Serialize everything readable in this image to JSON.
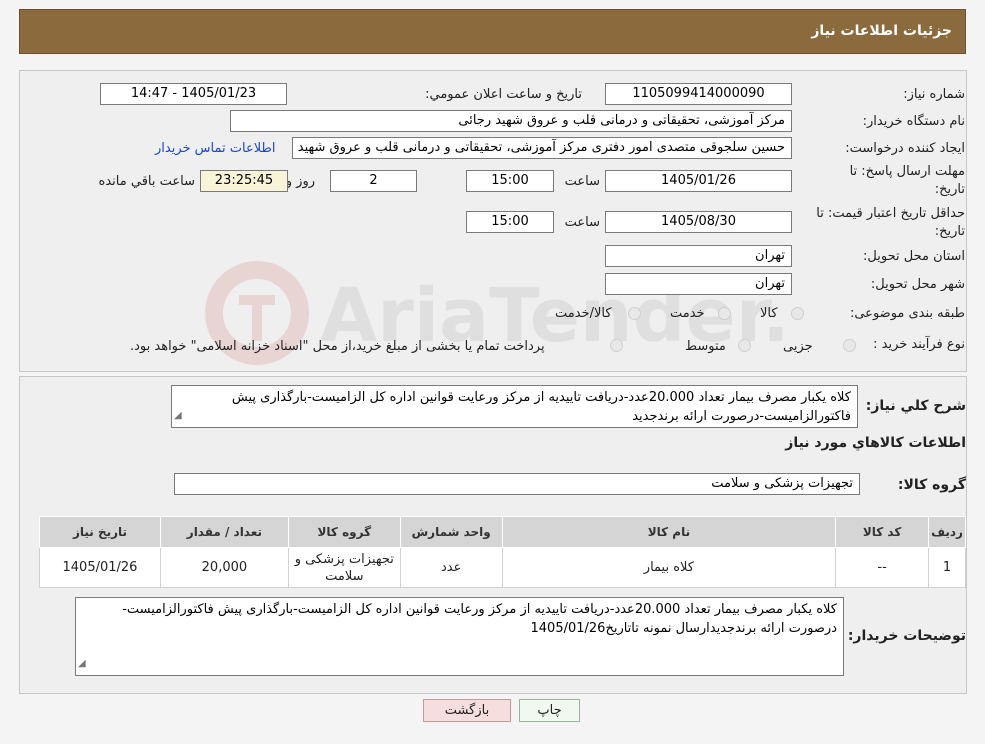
{
  "header": {
    "title": "جزئیات اطلاعات نیاز"
  },
  "form": {
    "need_number_label": "شماره نیاز:",
    "need_number": "1105099414000090",
    "announce_label": "تاریخ و ساعت اعلان عمومي:",
    "announce_value": "1405/01/23 - 14:47",
    "buyer_org_label": "نام دستگاه خریدار:",
    "buyer_org": "مرکز آموزشی، تحقیقاتی و درمانی قلب و عروق شهید رجائی",
    "creator_label": "ایجاد کننده درخواست:",
    "creator": "حسین سلجوقی متصدی امور دفتری مرکز آموزشی، تحقیقاتی و درمانی قلب و عروق شهید رجائی",
    "contact_link": "اطلاعات تماس خریدار",
    "deadline_label_1": "مهلت ارسال پاسخ: تا",
    "deadline_label_2": "تاریخ:",
    "deadline_date": "1405/01/26",
    "time_label": "ساعت",
    "deadline_time": "15:00",
    "days_value": "2",
    "days_label": "روز و",
    "remaining_value": "23:25:45",
    "remaining_label": "ساعت باقي مانده",
    "validity_label_1": "حداقل تاریخ اعتبار قیمت: تا",
    "validity_label_2": "تاریخ:",
    "validity_date": "1405/08/30",
    "validity_time": "15:00",
    "province_label": "استان محل تحویل:",
    "province": "تهران",
    "city_label": "شهر محل تحویل:",
    "city": "تهران",
    "category_label": "طبقه بندی موضوعی:",
    "category_options": [
      "کالا",
      "خدمت",
      "کالا/خدمت"
    ],
    "purchase_type_label": "نوع فرآیند خرید :",
    "purchase_type_options": [
      "جزیی",
      "متوسط"
    ],
    "purchase_note": "پرداخت تمام یا بخشی از مبلغ خرید،از محل \"اسناد خزانه اسلامی\" خواهد بود."
  },
  "description": {
    "label": "شرح کلي نياز:",
    "text": "کلاه یکبار مصرف بیمار تعداد 20.000عدد-دریافت تاییدیه از مرکز ورعایت قوانین اداره کل الزامیست-بارگذاری پیش فاکتورالزامیست-درصورت ارائه برندجدید"
  },
  "goods": {
    "section_title": "اطلاعات کالاهاي مورد نياز",
    "group_label": "گروه کالا:",
    "group_value": "تجهیزات پزشکی و سلامت",
    "table_headers": [
      "ردیف",
      "کد کالا",
      "نام کالا",
      "واحد شمارش",
      "گروه کالا",
      "تعداد / مقدار",
      "تاریخ نیاز"
    ],
    "rows": [
      [
        "1",
        "--",
        "کلاه بیمار",
        "عدد",
        "تجهیزات پزشکی و سلامت",
        "20,000",
        "1405/01/26"
      ]
    ]
  },
  "buyer_notes": {
    "label": "توضیحات خریدار:",
    "text": "کلاه یکبار مصرف بیمار تعداد 20.000عدد-دریافت تاییدیه از مرکز ورعایت قوانین اداره کل الزامیست-بارگذاری پیش فاکتورالزامیست-درصورت ارائه برندجدیدارسال نمونه تاتاریخ1405/01/26"
  },
  "buttons": {
    "print": "چاپ",
    "back": "بازگشت"
  },
  "watermark_text": "AriaTender.neT",
  "colors": {
    "header_bg": "#8b6a3e",
    "link": "#1c46c9",
    "back_btn": "#f6dede",
    "print_btn": "#f0f8ef"
  }
}
